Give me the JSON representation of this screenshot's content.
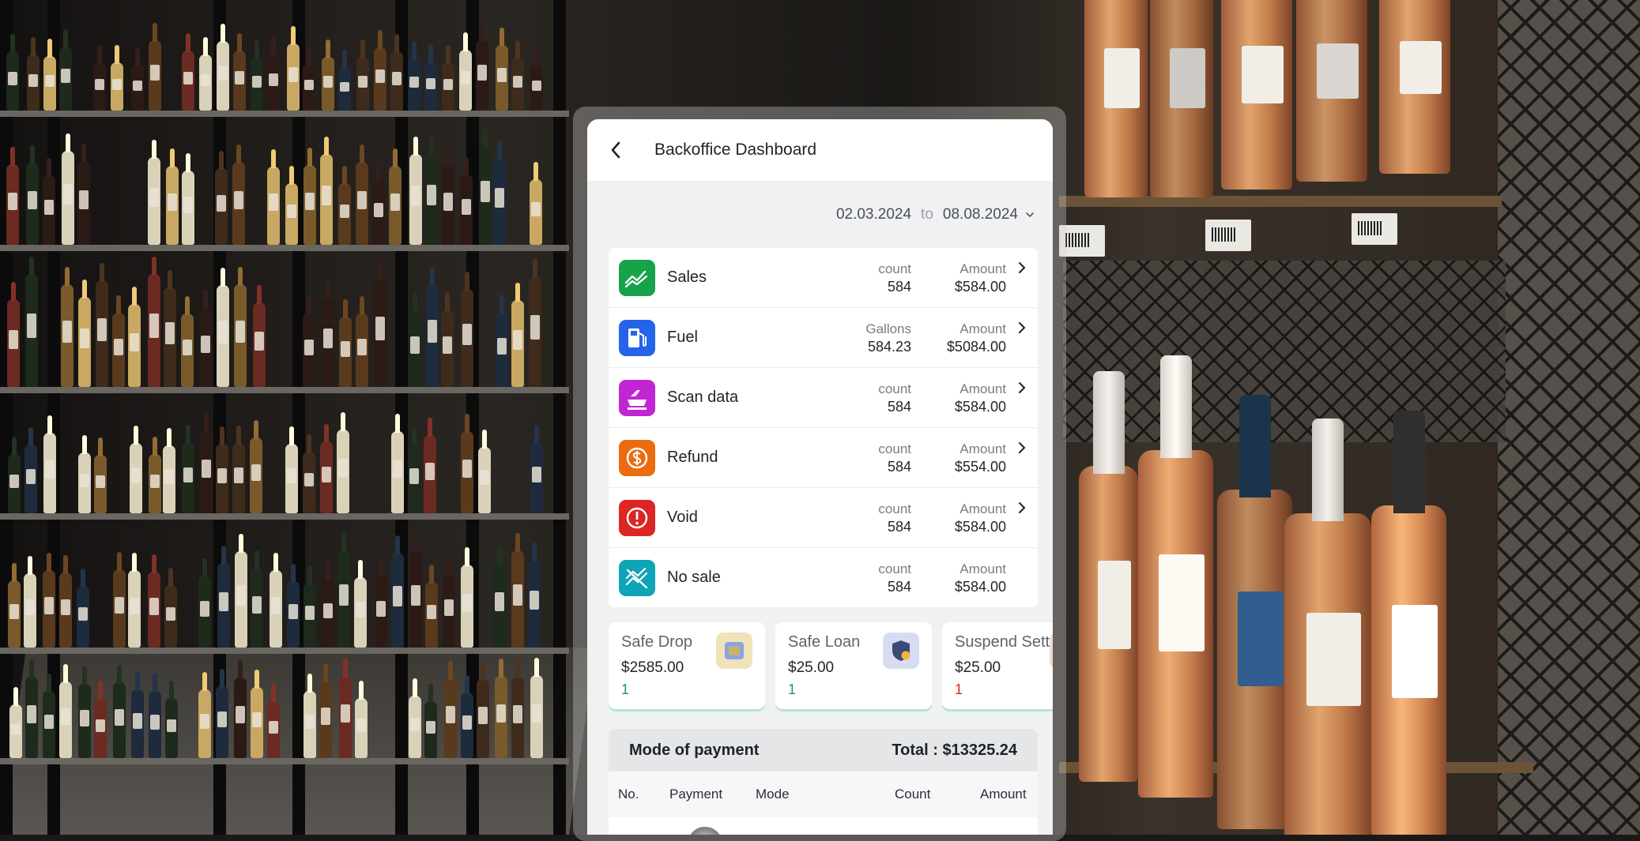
{
  "header": {
    "title": "Backoffice Dashboard"
  },
  "date_range": {
    "from": "02.03.2024",
    "separator": "to",
    "to": "08.08.2024"
  },
  "summary": [
    {
      "label": "Sales",
      "col1_header": "count",
      "col1_value": "584",
      "col2_header": "Amount",
      "col2_value": "$584.00",
      "icon": "chart-line-icon",
      "color": "#16a34a",
      "has_arrow": true
    },
    {
      "label": "Fuel",
      "col1_header": "Gallons",
      "col1_value": "584.23",
      "col2_header": "Amount",
      "col2_value": "$5084.00",
      "icon": "fuel-pump-icon",
      "color": "#2563eb",
      "has_arrow": true
    },
    {
      "label": "Scan data",
      "col1_header": "count",
      "col1_value": "584",
      "col2_header": "Amount",
      "col2_value": "$584.00",
      "icon": "scanner-icon",
      "color": "#c026d3",
      "has_arrow": true
    },
    {
      "label": "Refund",
      "col1_header": "count",
      "col1_value": "584",
      "col2_header": "Amount",
      "col2_value": "$554.00",
      "icon": "dollar-refund-icon",
      "color": "#ea6c0e",
      "has_arrow": true
    },
    {
      "label": "Void",
      "col1_header": "count",
      "col1_value": "584",
      "col2_header": "Amount",
      "col2_value": "$584.00",
      "icon": "alert-icon",
      "color": "#dc2626",
      "has_arrow": true
    },
    {
      "label": "No sale",
      "col1_header": "count",
      "col1_value": "584",
      "col2_header": "Amount",
      "col2_value": "$584.00",
      "icon": "no-sale-icon",
      "color": "#0ea5b7",
      "has_arrow": false
    }
  ],
  "tiles": [
    {
      "name": "Safe Drop",
      "amount": "$2585.00",
      "count": "1",
      "count_color": "#16a34a",
      "icon": "safe-drop-icon",
      "icon_bg": "#efe3b8"
    },
    {
      "name": "Safe Loan",
      "amount": "$25.00",
      "count": "1",
      "count_color": "#16a34a",
      "icon": "shield-coin-icon",
      "icon_bg": "#d8dcf3"
    },
    {
      "name": "Suspend Sett",
      "amount": "$25.00",
      "count": "1",
      "count_color": "#dc2626",
      "icon": "suspend-icon",
      "icon_bg": "#f3dada"
    }
  ],
  "mode_of_payment": {
    "title": "Mode of payment",
    "total_label": "Total",
    "total_value": ": $13325.24",
    "columns": [
      "No.",
      "Payment",
      "Mode",
      "Count",
      "Amount"
    ]
  }
}
